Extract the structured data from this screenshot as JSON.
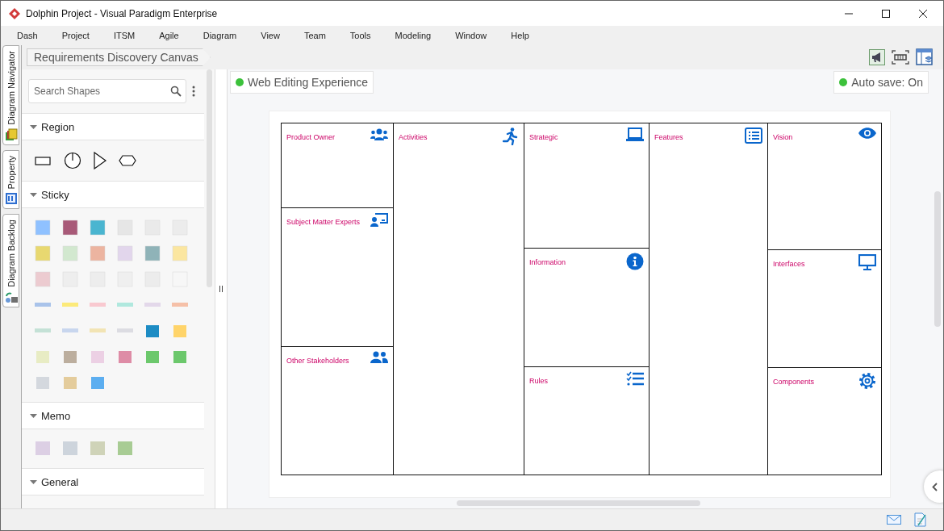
{
  "window": {
    "title": "Dolphin Project - Visual Paradigm Enterprise"
  },
  "menu": [
    "Dash",
    "Project",
    "ITSM",
    "Agile",
    "Diagram",
    "View",
    "Team",
    "Tools",
    "Modeling",
    "Window",
    "Help"
  ],
  "side_tabs": [
    {
      "label": "Diagram Navigator",
      "kind": "navigator"
    },
    {
      "label": "Property",
      "kind": "property"
    },
    {
      "label": "Diagram Backlog",
      "kind": "backlog"
    }
  ],
  "breadcrumb": "Requirements Discovery Canvas",
  "palette": {
    "search": {
      "placeholder": "Search Shapes"
    },
    "sections": [
      {
        "title": "Region",
        "kind": "region",
        "expanded": true
      },
      {
        "title": "Sticky",
        "kind": "sticky",
        "expanded": true
      },
      {
        "title": "Memo",
        "kind": "memo",
        "expanded": true
      },
      {
        "title": "General",
        "kind": "general",
        "expanded": true
      }
    ]
  },
  "badges": [
    {
      "label": "Web Editing Experience",
      "on": true
    },
    {
      "label": "Auto save: On",
      "on": true
    }
  ],
  "canvas": {
    "columns": [
      {
        "cells": [
          {
            "title": "Product Owner",
            "kind": "group"
          },
          {
            "title": "Subject Matter Experts",
            "kind": "presenter"
          },
          {
            "title": "Other Stakeholders",
            "kind": "pair"
          }
        ]
      },
      {
        "cells": [
          {
            "title": "Activities",
            "kind": "runner"
          }
        ]
      },
      {
        "cells": [
          {
            "title": "Strategic",
            "kind": "laptop"
          },
          {
            "title": "Information",
            "kind": "info"
          },
          {
            "title": "Rules",
            "kind": "checklist"
          }
        ]
      },
      {
        "cells": [
          {
            "title": "Features",
            "kind": "list"
          }
        ]
      },
      {
        "cells": [
          {
            "title": "Vision",
            "kind": "eye"
          },
          {
            "title": "Interfaces",
            "kind": "monitor"
          },
          {
            "title": "Components",
            "kind": "gear"
          }
        ]
      }
    ]
  }
}
